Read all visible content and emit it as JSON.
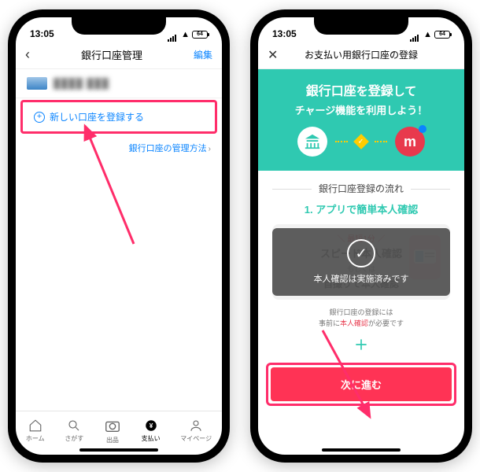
{
  "statusbar": {
    "time": "13:05",
    "battery": "64"
  },
  "left": {
    "nav": {
      "title": "銀行口座管理",
      "edit": "編集"
    },
    "account": {
      "masked_name": "████ ███",
      "masked_num": "████"
    },
    "add_label": "新しい口座を登録する",
    "manage_link": "銀行口座の管理方法",
    "tabs": {
      "home": "ホーム",
      "search": "さがす",
      "sell": "出品",
      "pay": "支払い",
      "mypage": "マイページ"
    }
  },
  "right": {
    "nav": {
      "title": "お支払い用銀行口座の登録"
    },
    "hero": {
      "line1_a": "銀行口座",
      "line1_b": "を",
      "line1_c": "登録",
      "line1_d": "して",
      "line2": "チャージ機能を利用しよう！"
    },
    "flow_label": "銀行口座登録の流れ",
    "step1": {
      "num": "1.",
      "text": "アプリで簡単本人確認"
    },
    "card": {
      "tag": "＼ 最短1分 ／",
      "speed": "スピード本人確認",
      "or": "もしくは",
      "selfie": "自撮りで本人確認"
    },
    "overlay": {
      "text": "本人確認は実施済みです"
    },
    "note": {
      "line1": "銀行口座の登録には",
      "line2a": "事前に",
      "line2b": "本人確認",
      "line2c": "が必要です"
    },
    "cta": "次に進む"
  }
}
